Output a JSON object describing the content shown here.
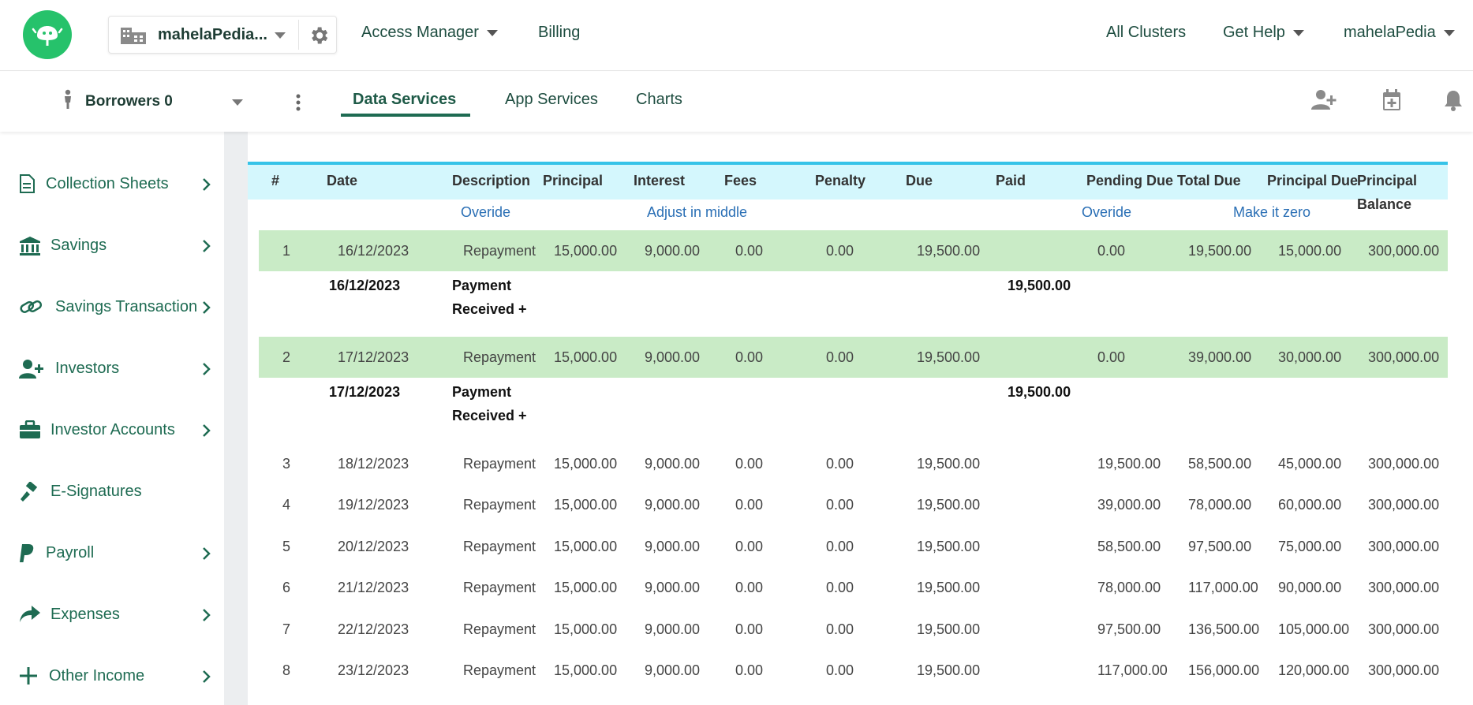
{
  "topbar": {
    "org_name": "mahelaPedia...",
    "nav": [
      {
        "label": "Access Manager",
        "has_caret": true
      },
      {
        "label": "Billing",
        "has_caret": false
      }
    ],
    "right": [
      {
        "label": "All Clusters",
        "has_caret": false
      },
      {
        "label": "Get Help",
        "has_caret": true
      },
      {
        "label": "mahelaPedia",
        "has_caret": true
      }
    ]
  },
  "subbar": {
    "borrowers_label": "Borrowers 0",
    "tabs": [
      "Data Services",
      "App Services",
      "Charts"
    ],
    "active_tab": "Data Services"
  },
  "sidebar": {
    "items": [
      {
        "label": "Collection Sheets",
        "icon": "document-icon",
        "has_chevron": true
      },
      {
        "label": "Savings",
        "icon": "bank-icon",
        "has_chevron": true
      },
      {
        "label": "Savings Transaction",
        "icon": "link-icon",
        "has_chevron": true
      },
      {
        "label": "Investors",
        "icon": "add-user-icon",
        "has_chevron": true
      },
      {
        "label": "Investor Accounts",
        "icon": "briefcase-icon",
        "has_chevron": true
      },
      {
        "label": "E-Signatures",
        "icon": "gavel-icon",
        "has_chevron": false
      },
      {
        "label": "Payroll",
        "icon": "paypal-icon",
        "has_chevron": true
      },
      {
        "label": "Expenses",
        "icon": "share-icon",
        "has_chevron": true
      },
      {
        "label": "Other Income",
        "icon": "plus-icon",
        "has_chevron": true
      }
    ]
  },
  "table": {
    "headers": [
      "#",
      "Date",
      "Description",
      "Principal",
      "Interest",
      "Fees",
      "Penalty",
      "Due",
      "Paid",
      "Pending Due",
      "Total Due",
      "Principal Due",
      "Principal",
      "Balance"
    ],
    "links": [
      "Overide",
      "Adjust in middle",
      "Overide",
      "Make it zero"
    ],
    "rows": [
      {
        "no": "1",
        "date": "16/12/2023",
        "desc": "Repayment",
        "principal": "15,000.00",
        "interest": "9,000.00",
        "fees": "0.00",
        "penalty": "0.00",
        "due": "19,500.00",
        "paid": "",
        "pending": "0.00",
        "total": "19,500.00",
        "pdue": "15,000.00",
        "pbal": "300,000.00"
      },
      {
        "no": "2",
        "date": "17/12/2023",
        "desc": "Repayment",
        "principal": "15,000.00",
        "interest": "9,000.00",
        "fees": "0.00",
        "penalty": "0.00",
        "due": "19,500.00",
        "paid": "",
        "pending": "0.00",
        "total": "39,000.00",
        "pdue": "30,000.00",
        "pbal": "300,000.00"
      },
      {
        "no": "3",
        "date": "18/12/2023",
        "desc": "Repayment",
        "principal": "15,000.00",
        "interest": "9,000.00",
        "fees": "0.00",
        "penalty": "0.00",
        "due": "19,500.00",
        "paid": "",
        "pending": "19,500.00",
        "total": "58,500.00",
        "pdue": "45,000.00",
        "pbal": "300,000.00"
      },
      {
        "no": "4",
        "date": "19/12/2023",
        "desc": "Repayment",
        "principal": "15,000.00",
        "interest": "9,000.00",
        "fees": "0.00",
        "penalty": "0.00",
        "due": "19,500.00",
        "paid": "",
        "pending": "39,000.00",
        "total": "78,000.00",
        "pdue": "60,000.00",
        "pbal": "300,000.00"
      },
      {
        "no": "5",
        "date": "20/12/2023",
        "desc": "Repayment",
        "principal": "15,000.00",
        "interest": "9,000.00",
        "fees": "0.00",
        "penalty": "0.00",
        "due": "19,500.00",
        "paid": "",
        "pending": "58,500.00",
        "total": "97,500.00",
        "pdue": "75,000.00",
        "pbal": "300,000.00"
      },
      {
        "no": "6",
        "date": "21/12/2023",
        "desc": "Repayment",
        "principal": "15,000.00",
        "interest": "9,000.00",
        "fees": "0.00",
        "penalty": "0.00",
        "due": "19,500.00",
        "paid": "",
        "pending": "78,000.00",
        "total": "117,000.00",
        "pdue": "90,000.00",
        "pbal": "300,000.00"
      },
      {
        "no": "7",
        "date": "22/12/2023",
        "desc": "Repayment",
        "principal": "15,000.00",
        "interest": "9,000.00",
        "fees": "0.00",
        "penalty": "0.00",
        "due": "19,500.00",
        "paid": "",
        "pending": "97,500.00",
        "total": "136,500.00",
        "pdue": "105,000.00",
        "pbal": "300,000.00"
      },
      {
        "no": "8",
        "date": "23/12/2023",
        "desc": "Repayment",
        "principal": "15,000.00",
        "interest": "9,000.00",
        "fees": "0.00",
        "penalty": "0.00",
        "due": "19,500.00",
        "paid": "",
        "pending": "117,000.00",
        "total": "156,000.00",
        "pdue": "120,000.00",
        "pbal": "300,000.00"
      }
    ],
    "payments": [
      {
        "date": "16/12/2023",
        "label_line1": "Payment",
        "label_line2": "Received +",
        "amount": "19,500.00"
      },
      {
        "date": "17/12/2023",
        "label_line1": "Payment",
        "label_line2": "Received +",
        "amount": "19,500.00"
      }
    ]
  },
  "colors": {
    "brand_green": "#26c26b",
    "header_bg": "#d4f7fd",
    "header_border": "#36c3e8",
    "row_highlight": "#c9ebc6",
    "link": "#2a6fb5"
  }
}
